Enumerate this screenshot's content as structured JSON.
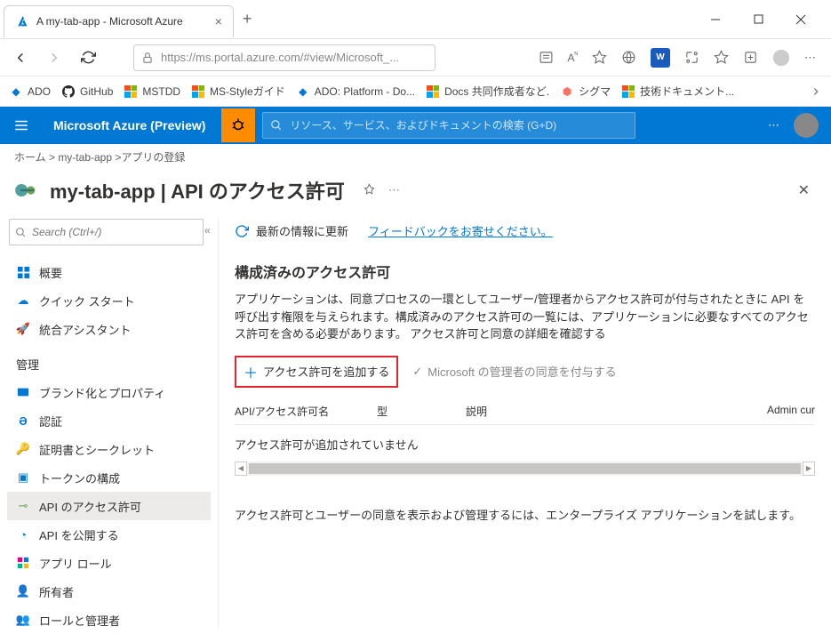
{
  "browser": {
    "tab_title": "A my-tab-app - Microsoft Azure",
    "url": "https://ms.portal.azure.com/#view/Microsoft_..."
  },
  "bookmarks": {
    "ado": "ADO",
    "github": "GitHub",
    "mstdd": "MSTDD",
    "msstyle": "MS-Styleガイド",
    "adoplatform": "ADO: Platform - Do...",
    "docs": "Docs 共同作成者など.",
    "sigma": "シグマ",
    "tech": "技術ドキュメント..."
  },
  "azure": {
    "brand": "Microsoft Azure (Preview)",
    "search_placeholder": "リソース、サービス、およびドキュメントの検索 (G+D)"
  },
  "breadcrumb": "ホーム >  my-tab-app >アプリの登録",
  "page": {
    "title": "my-tab-app | API のアクセス許可"
  },
  "sidebar": {
    "search_placeholder": "Search (Ctrl+/)",
    "items": {
      "overview": "概要",
      "quickstart": "クイック スタート",
      "integration": "統合アシスタント"
    },
    "section_manage": "管理",
    "manage": {
      "branding": "ブランド化とプロパティ",
      "auth": "認証",
      "certs": "証明書とシークレット",
      "tokens": "トークンの構成",
      "apiperm": "API のアクセス許可",
      "expose": "API を公開する",
      "approle": "アプリ ロール",
      "owners": "所有者",
      "roles": "ロールと管理者"
    }
  },
  "main": {
    "refresh": "最新の情報に更新",
    "feedback": "フィードバックをお寄せください。",
    "section_title": "構成済みのアクセス許可",
    "desc1": "アプリケーションは、同意プロセスの一環としてユーザー/管理者からアクセス許可が付与されたときに API を呼び出す権限を与えられます。構成済みのアクセス許可の一覧には、アプリケーションに必要なすべてのアクセス許可を含める必要があります。",
    "desc_link": "アクセス許可と同意の詳細を確認する",
    "add_permission": "アクセス許可を追加する",
    "grant_consent": "Microsoft の管理者の同意を付与する",
    "columns": {
      "name": "API/アクセス許可名",
      "type": "型",
      "desc": "説明",
      "admin": "Admin cur"
    },
    "empty": "アクセス許可が追加されていません",
    "footer": "アクセス許可とユーザーの同意を表示および管理するには、エンタープライズ アプリケーションを試します。"
  }
}
